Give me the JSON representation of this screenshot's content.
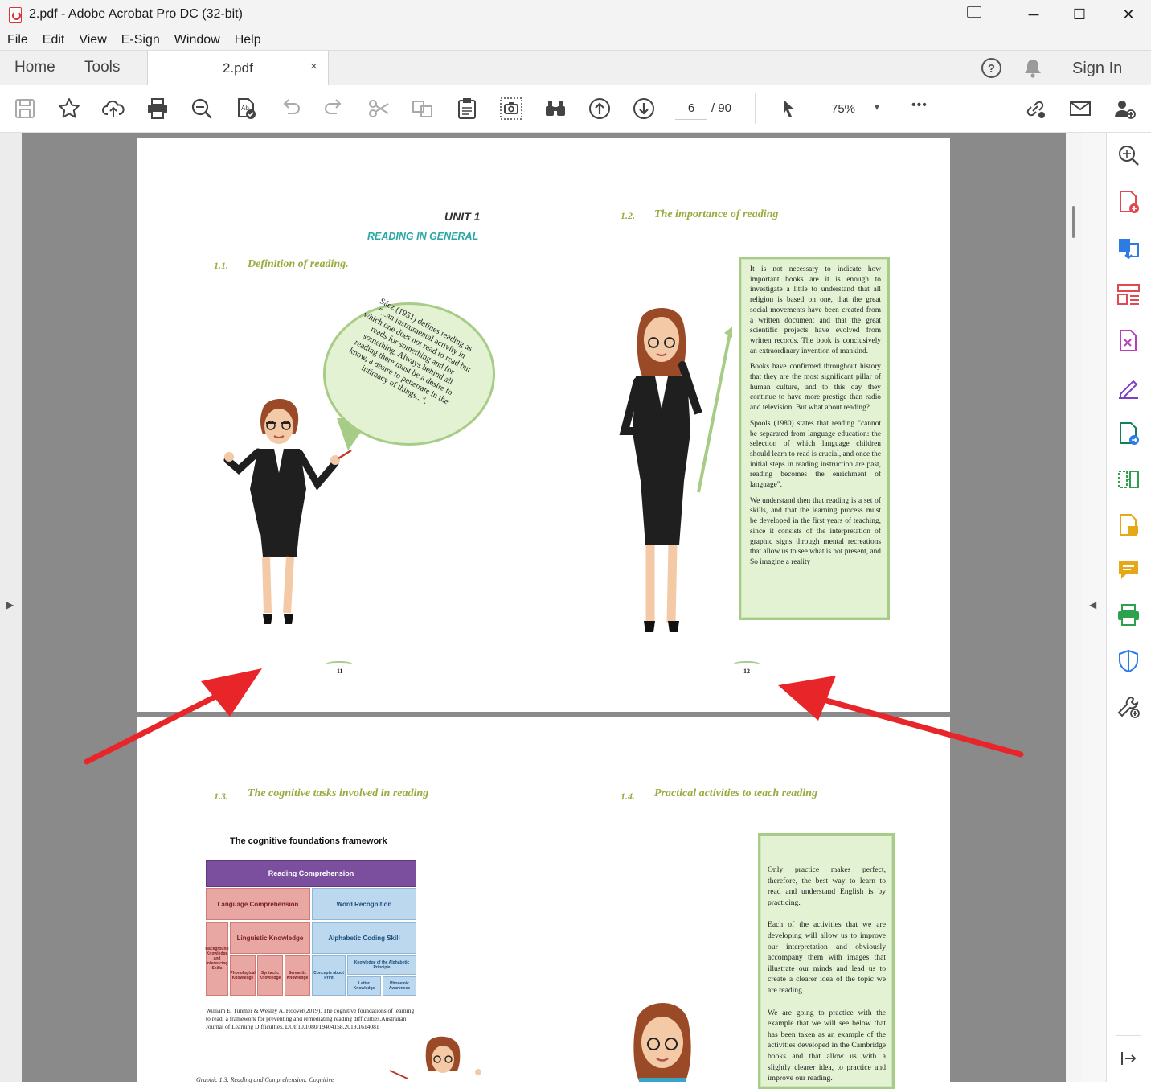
{
  "window": {
    "title": "2.pdf - Adobe Acrobat Pro DC (32-bit)",
    "minimize": "─",
    "maximize": "☐",
    "close": "✕"
  },
  "menu": [
    "File",
    "Edit",
    "View",
    "E-Sign",
    "Window",
    "Help"
  ],
  "tabs": {
    "home": "Home",
    "tools": "Tools",
    "document": "2.pdf",
    "close": "×",
    "sign_in": "Sign In"
  },
  "toolbar": {
    "page_current": "6",
    "page_total": "/ 90",
    "zoom": "75%",
    "zoom_caret": "▾",
    "more": "•••"
  },
  "panels": {
    "left_toggle": "▶",
    "right_toggle": "◀"
  },
  "page1": {
    "unit": "UNIT 1",
    "subtitle": "READING IN GENERAL",
    "h11_num": "1.1.",
    "h11_text": "Definition of reading.",
    "h12_num": "1.2.",
    "h12_text": "The importance of reading",
    "bubble": "Sáez (1951) defines reading as \"...an instrumental activity in which one does not read to read but reads for something and for something. Always behind all reading there must be a desire to know, a desire to penetrate in the intimacy of things...\".",
    "box_paragraphs": [
      "It is not necessary to indicate how important books are it is enough to investigate a little to understand that all religion is based on one, that the great social movements have been created from a written document and that the great scientific projects have evolved from written records. The book is conclusively an extraordinary invention of mankind.",
      "Books have confirmed throughout history that they are the most significant pillar of human culture, and to this day they continue to have more prestige than radio and television. But what about reading?",
      "Spools (1980) states that reading \"cannot be separated from language education: the selection of which language children should learn to read is crucial, and once the initial steps in reading instruction are past, reading becomes the enrichment of language\".",
      "We understand then that reading is a set of skills, and that the learning process must be developed in the first years of teaching, since it consists of the interpretation of graphic signs through mental recreations that allow us to see what is not present, and So imagine a reality"
    ],
    "page_left": "11",
    "page_right": "12"
  },
  "page2": {
    "h13_num": "1.3.",
    "h13_text": "The cognitive tasks involved in reading",
    "h14_num": "1.4.",
    "h14_text": "Practical activities to teach reading",
    "framework_title": "The cognitive foundations framework",
    "fw": {
      "reading_comp": "Reading Comprehension",
      "lang_comp": "Language Comprehension",
      "word_rec": "Word Recognition",
      "ling_know": "Linguistic Knowledge",
      "alpha_skill": "Alphabetic Coding Skill",
      "background": "Background Knowledge and Inferencing Skills",
      "phono": "Phonological Knowledge",
      "syntactic": "Syntactic Knowledge",
      "semantic": "Semantic Knowledge",
      "concepts_print": "Concepts about Print",
      "alpha_principle": "Knowledge of the Alphabetic Principle",
      "letter_know": "Letter Knowledge",
      "phonemic": "Phonemic Awareness"
    },
    "citation": "William E. Tunmer & Wesley A. Hoover(2019). The cognitive foundations of learning to read: a framework for preventing and remediating reading difficulties,Australian Journal of Learning Difficulties, DOI:10.1080/19404158.2019.1614081",
    "caption": "Graphic 1.3. Reading and Comprehension: Cognitive",
    "box_paragraphs": [
      "Only practice makes perfect, therefore, the best way to learn to read and understand English is by practicing.",
      "Each of the activities that we are developing will allow us to improve our interpretation and obviously accompany them with images that illustrate our minds and lead us to create a clearer idea of the topic we are reading.",
      "We are going to practice with the example that we will see below that has been taken as an example of the activities developed in the Cambridge books and that allow us with a slightly clearer idea, to practice and improve our reading."
    ]
  },
  "colors": {
    "accent_green": "#9aaa3d",
    "teal": "#2aa6a6",
    "box_green": "#a6cc86",
    "arrow_red": "#e8262a"
  }
}
